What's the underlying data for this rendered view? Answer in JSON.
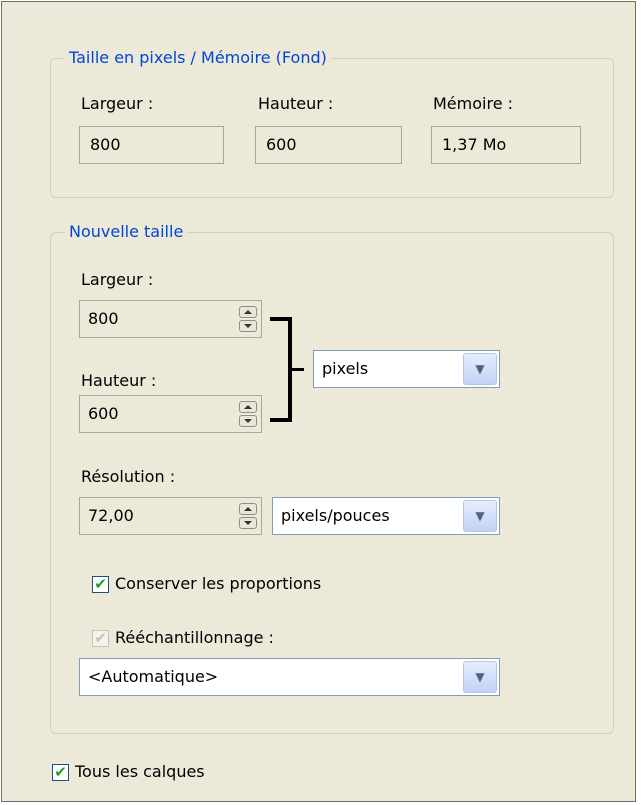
{
  "pixel_group": {
    "legend": "Taille en pixels / Mémoire (Fond)",
    "width_label": "Largeur :",
    "height_label": "Hauteur :",
    "memory_label": "Mémoire :",
    "width_value": "800",
    "height_value": "600",
    "memory_value": "1,37 Mo"
  },
  "new_size": {
    "legend": "Nouvelle taille",
    "width_label": "Largeur :",
    "width_value": "800",
    "height_label": "Hauteur :",
    "height_value": "600",
    "unit": "pixels",
    "resolution_label": "Résolution :",
    "resolution_value": "72,00",
    "resolution_unit": "pixels/pouces",
    "keep_ratio_label": "Conserver les proportions",
    "keep_ratio_checked": true,
    "resample_label": "Rééchantillonnage :",
    "resample_checked": true,
    "resample_value": "<Automatique>"
  },
  "all_layers": {
    "label": "Tous les calques",
    "checked": true
  },
  "icons": {
    "spin": "spin-up-down-icon",
    "dropdown": "chevron-down-icon",
    "check": "checkmark-icon"
  }
}
